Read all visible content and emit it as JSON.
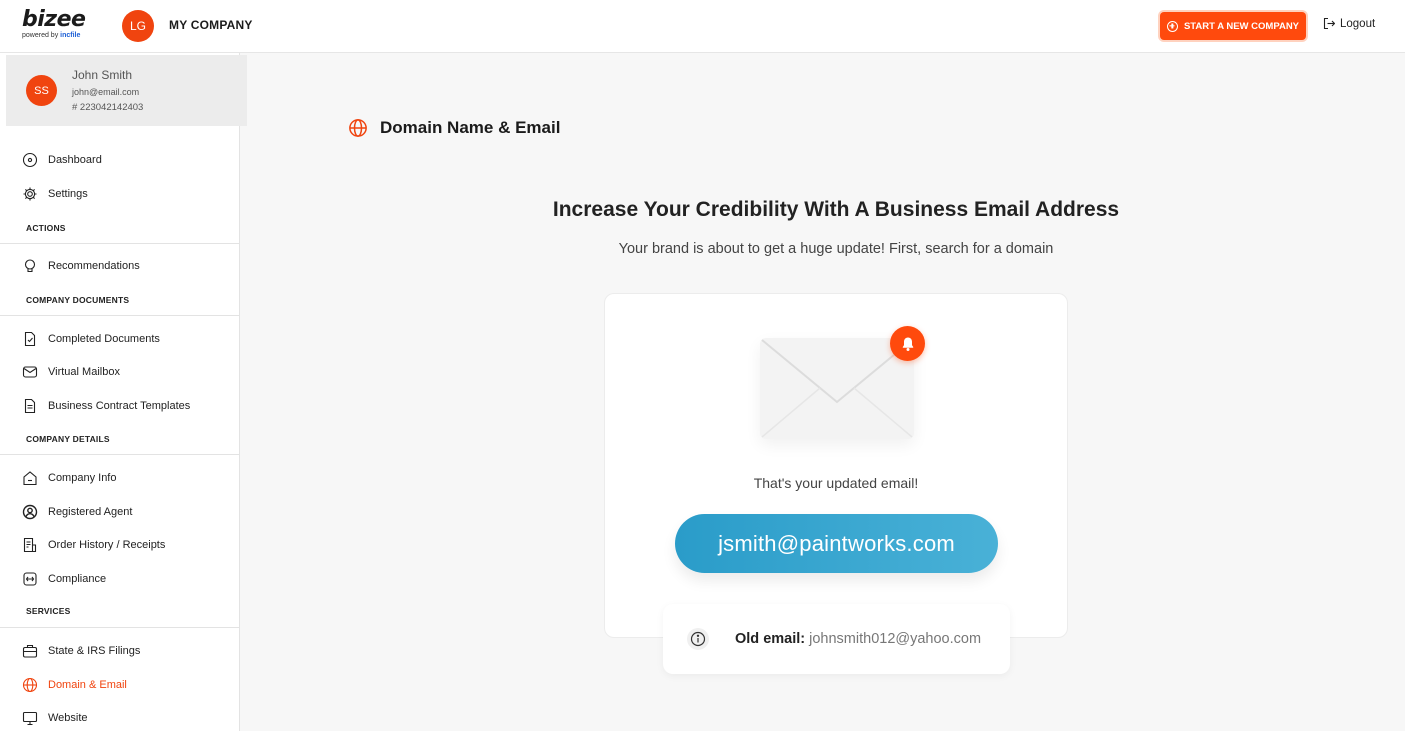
{
  "brand": {
    "name": "bizee",
    "powered_by": "powered by",
    "partner": "incfile"
  },
  "header": {
    "company_initials": "LG",
    "company_name": "MY COMPANY",
    "new_company_label": "START A NEW COMPANY",
    "logout_label": "Logout",
    "accent_color": "#ff4a0d"
  },
  "user": {
    "initials": "SS",
    "name": "John Smith",
    "email": "john@email.com",
    "id": "# 223042142403"
  },
  "sidebar": {
    "items": [
      {
        "label": "Dashboard",
        "icon": "dashboard-icon"
      },
      {
        "label": "Settings",
        "icon": "gear-icon"
      },
      {
        "label": "Recommendations",
        "icon": "lightbulb-icon"
      },
      {
        "label": "Completed Documents",
        "icon": "document-icon"
      },
      {
        "label": "Virtual Mailbox",
        "icon": "mailbox-icon"
      },
      {
        "label": "Business Contract Templates",
        "icon": "contract-icon"
      },
      {
        "label": "Company Info",
        "icon": "building-icon"
      },
      {
        "label": "Registered Agent",
        "icon": "user-circle-icon"
      },
      {
        "label": "Order History / Receipts",
        "icon": "receipt-icon"
      },
      {
        "label": "Compliance",
        "icon": "compliance-icon"
      },
      {
        "label": "State & IRS Filings",
        "icon": "briefcase-icon"
      },
      {
        "label": "Domain & Email",
        "icon": "globe-icon"
      },
      {
        "label": "Website",
        "icon": "monitor-icon"
      }
    ],
    "sections": [
      "ACTIONS",
      "COMPANY DOCUMENTS",
      "COMPANY DETAILS",
      "SERVICES"
    ]
  },
  "main": {
    "page_title": "Domain Name & Email",
    "headline": "Increase Your Credibility With A Business Email Address",
    "subheadline": "Your brand is about to get a huge update! First, search for a domain",
    "card": {
      "updated_label": "That's your updated email!",
      "new_email": "jsmith@paintworks.com",
      "old_email_label": "Old email:",
      "old_email_value": "johnsmith012@yahoo.com"
    }
  }
}
